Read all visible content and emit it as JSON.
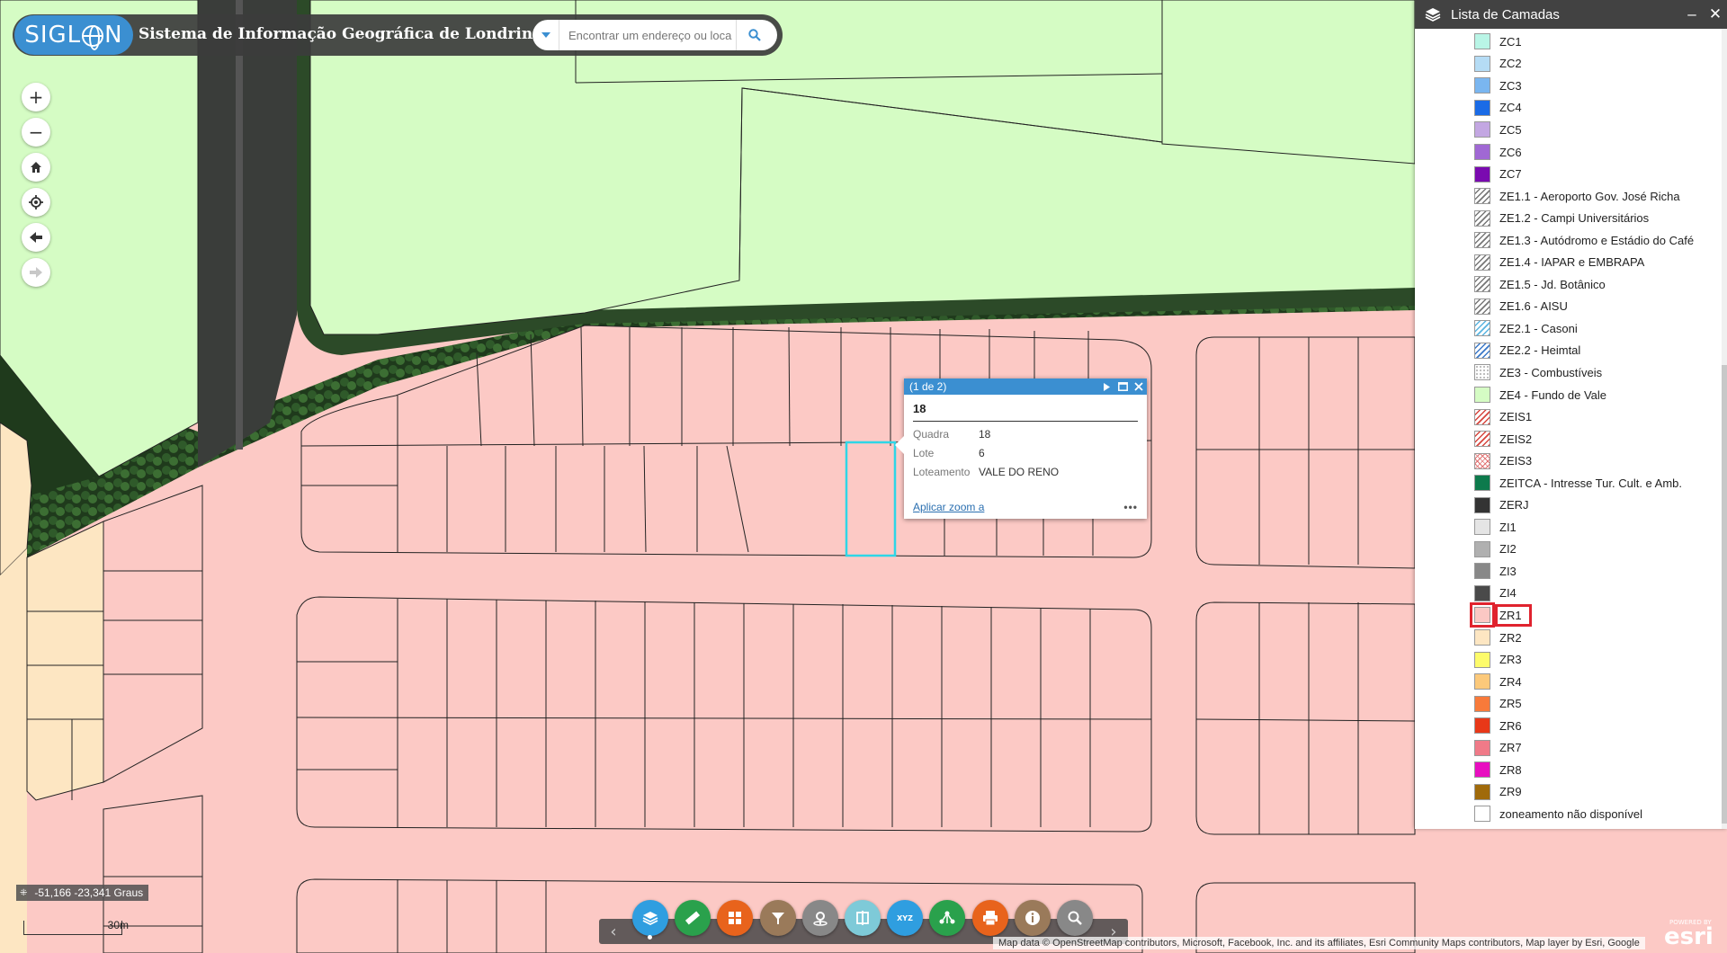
{
  "header": {
    "logo_text": "SIGL",
    "logo_suffix": "N",
    "title": "Sistema de Informação Geográfica de Londrina",
    "search_placeholder": "Encontrar um endereço ou loca"
  },
  "map_controls": [
    {
      "name": "zoom-in-button",
      "icon": "plus-icon",
      "glyph": "+"
    },
    {
      "name": "zoom-out-button",
      "icon": "minus-icon",
      "glyph": "−"
    },
    {
      "name": "home-button",
      "icon": "home-icon",
      "glyph": ""
    },
    {
      "name": "locate-button",
      "icon": "locate-icon",
      "glyph": ""
    },
    {
      "name": "back-button",
      "icon": "arrow-left-icon",
      "glyph": ""
    },
    {
      "name": "forward-button",
      "icon": "arrow-right-icon",
      "glyph": ""
    }
  ],
  "layer_panel": {
    "title": "Lista de Camadas",
    "minimize": "–",
    "close": "✕",
    "items": [
      {
        "label": "ZC1",
        "color": "#b9f5e6",
        "pattern": "solid"
      },
      {
        "label": "ZC2",
        "color": "#b5dcf5",
        "pattern": "solid"
      },
      {
        "label": "ZC3",
        "color": "#7ab6f0",
        "pattern": "solid"
      },
      {
        "label": "ZC4",
        "color": "#1a6be6",
        "pattern": "solid"
      },
      {
        "label": "ZC5",
        "color": "#c3a7e2",
        "pattern": "solid"
      },
      {
        "label": "ZC6",
        "color": "#a068d4",
        "pattern": "solid"
      },
      {
        "label": "ZC7",
        "color": "#7a0ab0",
        "pattern": "solid"
      },
      {
        "label": "ZE1.1 - Aeroporto Gov. José Richa",
        "color": "#777777",
        "pattern": "hatch"
      },
      {
        "label": "ZE1.2 - Campi Universitários",
        "color": "#777777",
        "pattern": "hatch"
      },
      {
        "label": "ZE1.3 - Autódromo e Estádio do Café",
        "color": "#777777",
        "pattern": "hatch"
      },
      {
        "label": "ZE1.4 - IAPAR e EMBRAPA",
        "color": "#777777",
        "pattern": "hatch"
      },
      {
        "label": "ZE1.5 - Jd. Botânico",
        "color": "#777777",
        "pattern": "hatch"
      },
      {
        "label": "ZE1.6 - AISU",
        "color": "#777777",
        "pattern": "hatch"
      },
      {
        "label": "ZE2.1 - Casoni",
        "color": "#5ab4e0",
        "pattern": "hatch"
      },
      {
        "label": "ZE2.2 - Heimtal",
        "color": "#3a78c8",
        "pattern": "hatch"
      },
      {
        "label": "ZE3 - Combustíveis",
        "color": "#aaaaaa",
        "pattern": "dots"
      },
      {
        "label": "ZE4 - Fundo de Vale",
        "color": "#d5fcc4",
        "pattern": "solid"
      },
      {
        "label": "ZEIS1",
        "color": "#d6453d",
        "pattern": "hatch"
      },
      {
        "label": "ZEIS2",
        "color": "#d6453d",
        "pattern": "hatch"
      },
      {
        "label": "ZEIS3",
        "color": "#e07070",
        "pattern": "cross"
      },
      {
        "label": "ZEITCA - Intresse Tur. Cult. e Amb.",
        "color": "#0d7a4c",
        "pattern": "solid"
      },
      {
        "label": "ZERJ",
        "color": "#333333",
        "pattern": "solid"
      },
      {
        "label": "ZI1",
        "color": "#e5e5e5",
        "pattern": "solid"
      },
      {
        "label": "ZI2",
        "color": "#b0b0b0",
        "pattern": "solid"
      },
      {
        "label": "ZI3",
        "color": "#888888",
        "pattern": "solid"
      },
      {
        "label": "ZI4",
        "color": "#4a4a4a",
        "pattern": "solid"
      },
      {
        "label": "ZR1",
        "color": "#fbc8c4",
        "pattern": "solid",
        "highlighted": true
      },
      {
        "label": "ZR2",
        "color": "#fde6c2",
        "pattern": "solid"
      },
      {
        "label": "ZR3",
        "color": "#fdfb6a",
        "pattern": "solid"
      },
      {
        "label": "ZR4",
        "color": "#fcc97a",
        "pattern": "solid"
      },
      {
        "label": "ZR5",
        "color": "#f87a3a",
        "pattern": "solid"
      },
      {
        "label": "ZR6",
        "color": "#e83818",
        "pattern": "solid"
      },
      {
        "label": "ZR7",
        "color": "#f07a88",
        "pattern": "solid"
      },
      {
        "label": "ZR8",
        "color": "#e80ec0",
        "pattern": "solid"
      },
      {
        "label": "ZR9",
        "color": "#a06a0a",
        "pattern": "solid"
      },
      {
        "label": "zoneamento não disponível",
        "color": "#ffffff",
        "pattern": "solid"
      }
    ]
  },
  "popup": {
    "counter": "(1 de 2)",
    "name": "18",
    "fields": [
      {
        "key": "Quadra",
        "value": "18"
      },
      {
        "key": "Lote",
        "value": "6"
      },
      {
        "key": "Loteamento",
        "value": "VALE DO RENO"
      }
    ],
    "zoom_link": "Aplicar zoom a",
    "more": "•••"
  },
  "status": {
    "coordinates": "-51,166 -23,341 Graus",
    "scale_label": "30m"
  },
  "toolbar": [
    {
      "name": "layers-tool-button",
      "icon": "layers-icon",
      "color": "#2f9ee0"
    },
    {
      "name": "measure-tool-button",
      "icon": "ruler-icon",
      "color": "#2aa14c"
    },
    {
      "name": "basemap-tool-button",
      "icon": "grid-icon",
      "color": "#e8631c"
    },
    {
      "name": "filter-tool-button",
      "icon": "filter-icon",
      "color": "#9a7a5a"
    },
    {
      "name": "location-tool-button",
      "icon": "pin-icon",
      "color": "#888888"
    },
    {
      "name": "swipe-tool-button",
      "icon": "swipe-icon",
      "color": "#7ecad8"
    },
    {
      "name": "xyz-tool-button",
      "icon": "xyz-icon",
      "color": "#2f9ee0"
    },
    {
      "name": "share-tool-button",
      "icon": "share-icon",
      "color": "#2aa14c"
    },
    {
      "name": "print-tool-button",
      "icon": "print-icon",
      "color": "#e8631c"
    },
    {
      "name": "info-tool-button",
      "icon": "info-icon",
      "color": "#9a7a5a"
    },
    {
      "name": "search-tool-button",
      "icon": "zoom-search-icon",
      "color": "#888888"
    }
  ],
  "attribution": "Map data © OpenStreetMap contributors, Microsoft, Facebook, Inc. and its affiliates, Esri Community Maps contributors, Map layer by Esri, Google",
  "esri": {
    "powered": "POWERED BY",
    "name": "esri"
  },
  "map_colors": {
    "fundo_de_vale": "#d5fcc4",
    "residencial": "#fcc9c5",
    "zr2": "#fde6c2",
    "selection": "#2fd6e6"
  }
}
